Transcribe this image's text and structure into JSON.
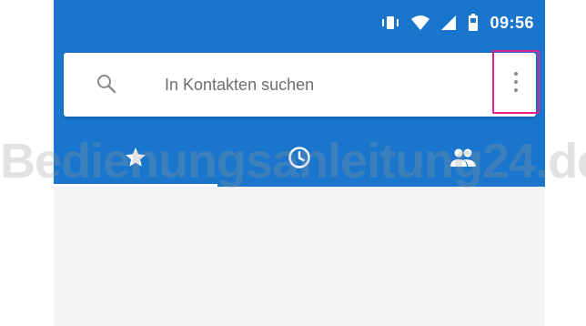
{
  "status_bar": {
    "time": "09:56",
    "icons": [
      "vibrate-icon",
      "wifi-icon",
      "signal-icon",
      "battery-icon"
    ]
  },
  "search": {
    "placeholder": "In Kontakten suchen",
    "value": "",
    "icon": "search-icon",
    "more_icon": "more-vert-icon",
    "highlight_color": "#e2238f"
  },
  "tabs": [
    {
      "icon": "star-icon",
      "name": "favorites"
    },
    {
      "icon": "clock-icon",
      "name": "recent"
    },
    {
      "icon": "people-icon",
      "name": "contacts"
    }
  ],
  "watermark": "Bedienungsanleitung24.de",
  "colors": {
    "app_bar": "#1976cc",
    "content_bg": "#f3f4f6"
  }
}
